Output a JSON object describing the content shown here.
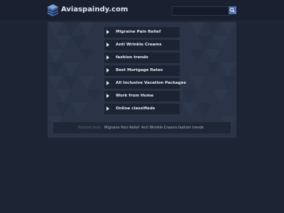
{
  "header": {
    "site_name": "Aviaspaindy.com",
    "logo_icon": "cube-stack-icon",
    "search": {
      "placeholder": "",
      "value": "",
      "button_icon": "search-icon"
    }
  },
  "main": {
    "links": [
      {
        "label": "Migraine Pain Relief"
      },
      {
        "label": "Anti Wrinkle Creams"
      },
      {
        "label": "fashion trends"
      },
      {
        "label": "Best Mortgage Rates"
      },
      {
        "label": "All Inclusive Vacation Packages"
      },
      {
        "label": "Work from Home"
      },
      {
        "label": "Online classifieds"
      }
    ],
    "related": {
      "title": "Related links",
      "links": [
        {
          "label": "Migraine Pain Relief"
        },
        {
          "label": "Anti Wrinkle Creams"
        },
        {
          "label": "fashion trends"
        }
      ]
    }
  },
  "colors": {
    "background": "#1d2434",
    "panel": "#2a3446",
    "link_item": "#1c2434",
    "accent": "#4b72b0"
  }
}
